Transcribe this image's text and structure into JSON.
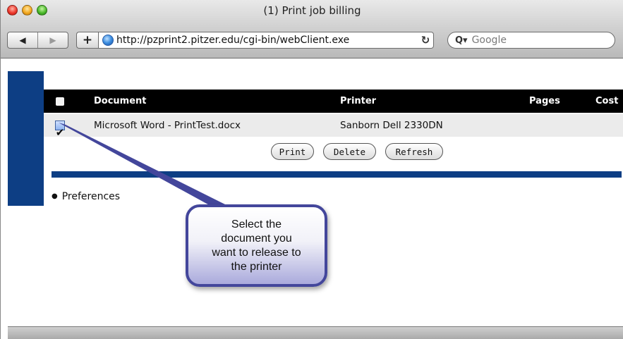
{
  "window": {
    "title": "(1) Print job billing"
  },
  "toolbar": {
    "back_icon": "◀",
    "forward_icon": "▶",
    "add_bookmark_icon": "+",
    "url": "http://pzprint2.pitzer.edu/cgi-bin/webClient.exe",
    "reload_icon": "↻",
    "search_icon": "Q▾",
    "search_placeholder": "Google"
  },
  "table": {
    "headers": {
      "document": "Document",
      "printer": "Printer",
      "pages": "Pages",
      "cost": "Cost"
    },
    "rows": [
      {
        "checked": true,
        "document": "Microsoft Word - PrintTest.docx",
        "printer": "Sanborn Dell 2330DN",
        "pages": "",
        "cost": ""
      }
    ]
  },
  "actions": {
    "print": "Print",
    "delete": "Delete",
    "refresh": "Refresh"
  },
  "links": {
    "preferences": "Preferences"
  },
  "callout": {
    "text": "Select the\ndocument you\nwant to release to\nthe printer"
  },
  "colors": {
    "accent_blue": "#0d3e84",
    "callout_border": "#43469b"
  }
}
